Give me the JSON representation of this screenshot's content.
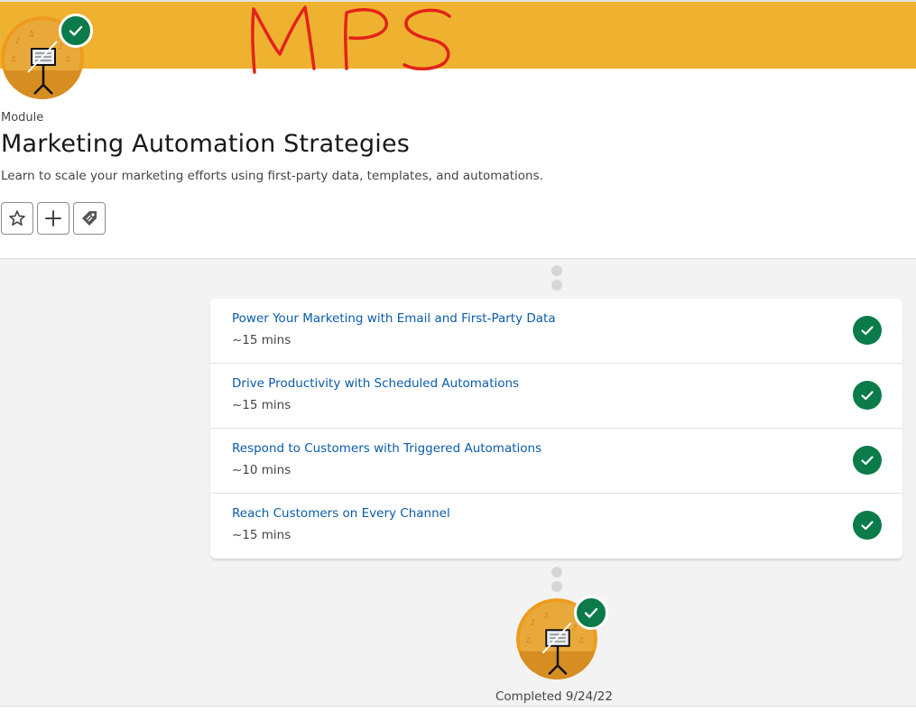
{
  "header": {
    "annotation_text": "MPS",
    "module_label": "Module",
    "title": "Marketing Automation Strategies",
    "description": "Learn to scale your marketing efforts using first-party data, templates, and automations."
  },
  "actions": [
    {
      "name": "favorite",
      "icon": "star-icon"
    },
    {
      "name": "add-to-list",
      "icon": "plus-icon"
    },
    {
      "name": "tag",
      "icon": "tag-icon"
    }
  ],
  "units": [
    {
      "title": "Power Your Marketing with Email and First-Party Data",
      "time": "~15 mins",
      "completed": true
    },
    {
      "title": "Drive Productivity with Scheduled Automations",
      "time": "~15 mins",
      "completed": true
    },
    {
      "title": "Respond to Customers with Triggered Automations",
      "time": "~10 mins",
      "completed": true
    },
    {
      "title": "Reach Customers on Every Channel",
      "time": "~15 mins",
      "completed": true
    }
  ],
  "footer": {
    "completed_text": "Completed 9/24/22"
  },
  "colors": {
    "banner": "#efb230",
    "link": "#0b5cab",
    "success": "#0a7b49",
    "annotation": "#e2231a"
  }
}
